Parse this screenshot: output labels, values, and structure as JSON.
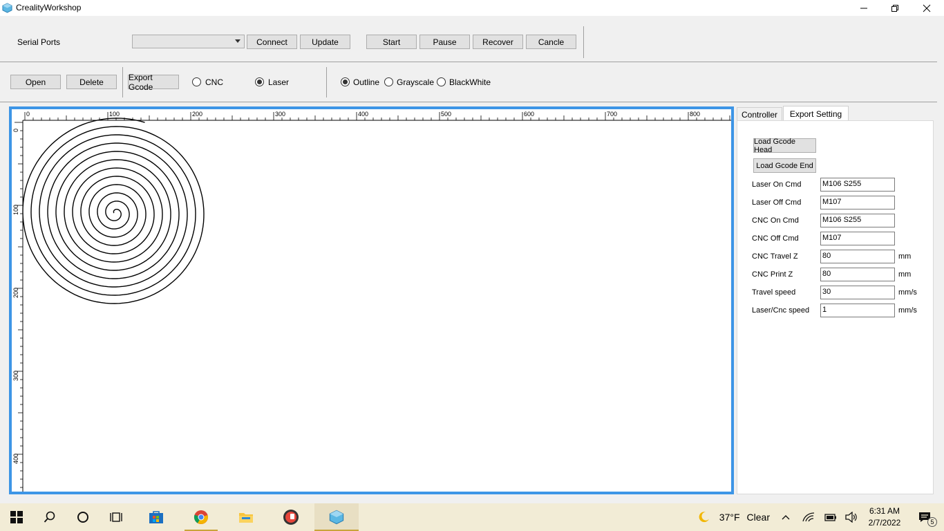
{
  "window": {
    "title": "CrealityWorkshop",
    "minimize_icon": "minimize-icon",
    "maximize_icon": "restore-icon",
    "close_icon": "close-icon"
  },
  "toolbar1": {
    "serial_label": "Serial Ports",
    "serial_value": "",
    "connect": "Connect",
    "update": "Update",
    "start": "Start",
    "pause": "Pause",
    "recover": "Recover",
    "cancle": "Cancle"
  },
  "toolbar2": {
    "open": "Open",
    "delete": "Delete",
    "export_gcode": "Export Gcode",
    "mode_cnc": "CNC",
    "mode_laser": "Laser",
    "mode_selected": "Laser",
    "render_outline": "Outline",
    "render_grayscale": "Grayscale",
    "render_blackwhite": "BlackWhite",
    "render_selected": "Outline"
  },
  "canvas": {
    "ruler_top_labels": [
      "0",
      "100",
      "200",
      "300",
      "400",
      "500",
      "600",
      "700",
      "800"
    ],
    "ruler_left_labels": [
      "0",
      "100",
      "200",
      "300",
      "400"
    ],
    "accent": "#3d95e6"
  },
  "panel": {
    "tab_controller": "Controller",
    "tab_export": "Export Setting",
    "active_tab": "Export Setting",
    "load_head": "Load Gcode Head",
    "load_end": "Load Gcode End",
    "fields": [
      {
        "label": "Laser On Cmd",
        "value": "M106 S255",
        "unit": ""
      },
      {
        "label": "Laser Off Cmd",
        "value": "M107",
        "unit": ""
      },
      {
        "label": "CNC On Cmd",
        "value": "M106 S255",
        "unit": ""
      },
      {
        "label": "CNC Off Cmd",
        "value": "M107",
        "unit": ""
      },
      {
        "label": "CNC Travel Z",
        "value": "80",
        "unit": "mm"
      },
      {
        "label": "CNC Print Z",
        "value": "80",
        "unit": "mm"
      },
      {
        "label": "Travel speed",
        "value": "30",
        "unit": "mm/s"
      },
      {
        "label": "Laser/Cnc speed",
        "value": "1",
        "unit": "mm/s"
      }
    ]
  },
  "taskbar": {
    "weather_temp": "37°F",
    "weather_text": "Clear",
    "time": "6:31 AM",
    "date": "2/7/2022",
    "notification_count": "5"
  }
}
